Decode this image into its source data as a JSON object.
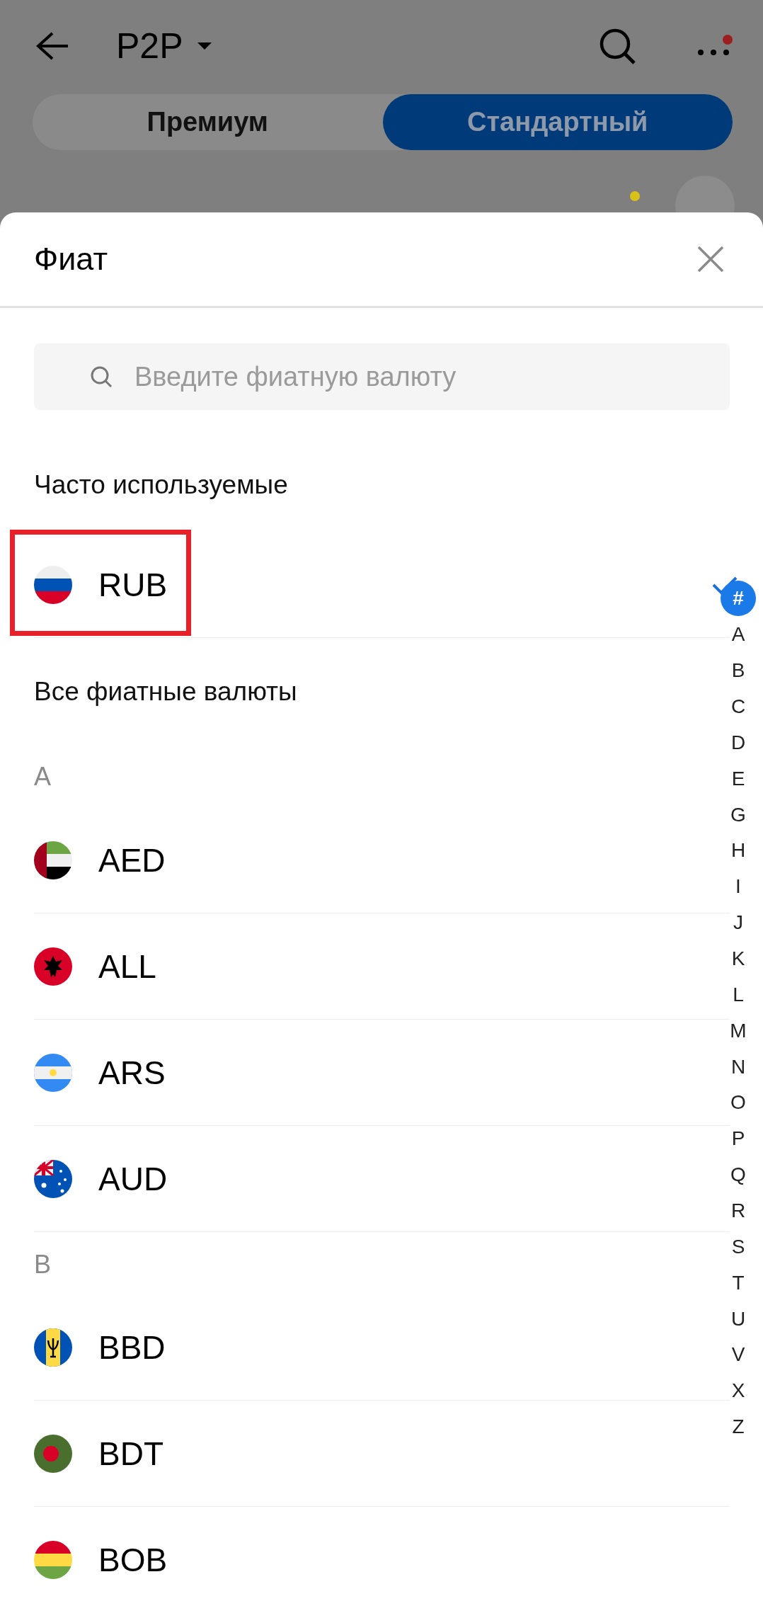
{
  "header": {
    "title": "P2P",
    "tabs": [
      {
        "label": "Премиум",
        "selected": false
      },
      {
        "label": "Стандартный",
        "selected": true
      }
    ]
  },
  "sheet": {
    "title": "Фиат",
    "search": {
      "placeholder": "Введите фиатную валюту"
    },
    "frequent": {
      "heading": "Часто используемые",
      "items": [
        {
          "code": "RUB",
          "selected": true,
          "highlighted": true
        }
      ]
    },
    "all": {
      "heading": "Все фиатные валюты",
      "groups": [
        {
          "letter": "A",
          "items": [
            {
              "code": "AED",
              "selected": false,
              "highlighted": false
            },
            {
              "code": "ALL",
              "selected": false,
              "highlighted": false
            },
            {
              "code": "ARS",
              "selected": false,
              "highlighted": false
            },
            {
              "code": "AUD",
              "selected": false,
              "highlighted": false
            }
          ]
        },
        {
          "letter": "B",
          "items": [
            {
              "code": "BBD",
              "selected": false,
              "highlighted": false
            },
            {
              "code": "BDT",
              "selected": false,
              "highlighted": false
            },
            {
              "code": "BOB",
              "selected": false,
              "highlighted": false
            }
          ]
        }
      ]
    },
    "index": [
      {
        "label": "#",
        "selected": true
      },
      {
        "label": "A",
        "selected": false
      },
      {
        "label": "B",
        "selected": false
      },
      {
        "label": "C",
        "selected": false
      },
      {
        "label": "D",
        "selected": false
      },
      {
        "label": "E",
        "selected": false
      },
      {
        "label": "G",
        "selected": false
      },
      {
        "label": "H",
        "selected": false
      },
      {
        "label": "I",
        "selected": false
      },
      {
        "label": "J",
        "selected": false
      },
      {
        "label": "K",
        "selected": false
      },
      {
        "label": "L",
        "selected": false
      },
      {
        "label": "M",
        "selected": false
      },
      {
        "label": "N",
        "selected": false
      },
      {
        "label": "O",
        "selected": false
      },
      {
        "label": "P",
        "selected": false
      },
      {
        "label": "Q",
        "selected": false
      },
      {
        "label": "R",
        "selected": false
      },
      {
        "label": "S",
        "selected": false
      },
      {
        "label": "T",
        "selected": false
      },
      {
        "label": "U",
        "selected": false
      },
      {
        "label": "V",
        "selected": false
      },
      {
        "label": "X",
        "selected": false
      },
      {
        "label": "Z",
        "selected": false
      }
    ]
  }
}
